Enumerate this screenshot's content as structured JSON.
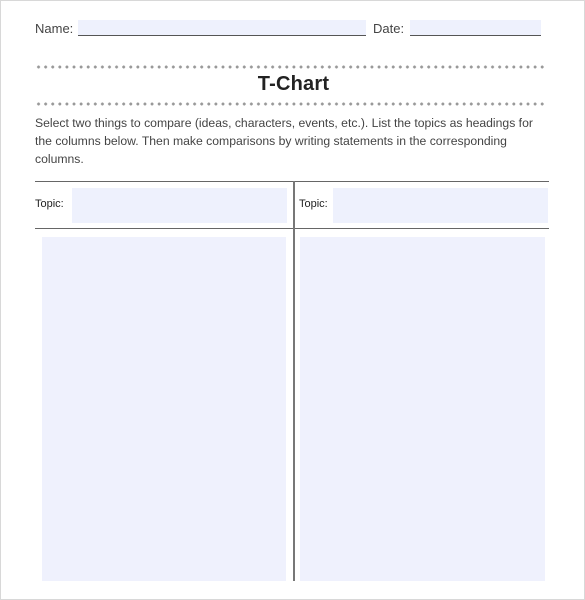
{
  "header": {
    "name_label": "Name:",
    "name_value": "",
    "date_label": "Date:",
    "date_value": ""
  },
  "title": "T-Chart",
  "instructions": "Select two things to compare (ideas, characters, events, etc.). List the topics as headings for the columns below. Then make comparisons by writing statements in the corresponding columns.",
  "columns": [
    {
      "topic_label": "Topic:",
      "topic_value": "",
      "content": ""
    },
    {
      "topic_label": "Topic:",
      "topic_value": "",
      "content": ""
    }
  ],
  "colors": {
    "field_fill": "#eef1fd",
    "divider": "#777777",
    "dots": "#999999"
  }
}
